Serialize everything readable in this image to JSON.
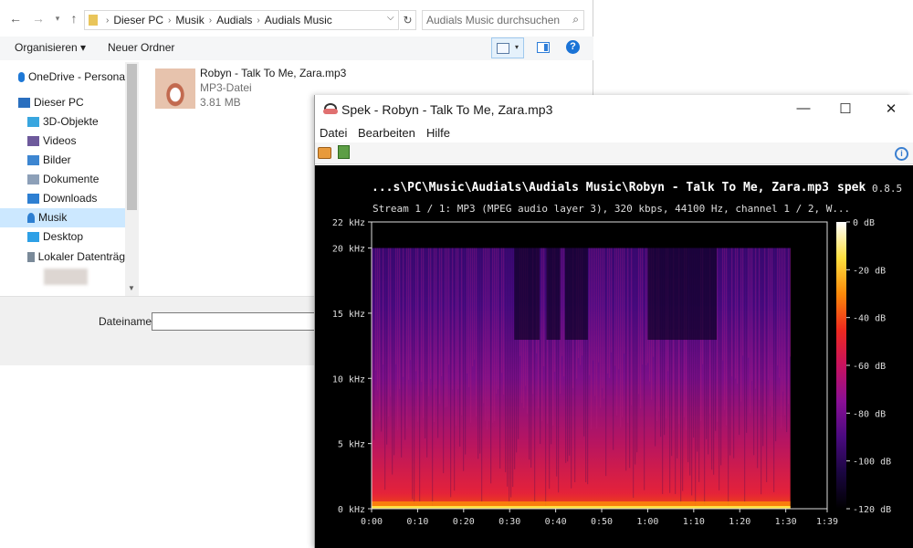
{
  "explorer": {
    "breadcrumb": [
      "Dieser PC",
      "Musik",
      "Audials",
      "Audials Music"
    ],
    "search_placeholder": "Audials Music durchsuchen",
    "toolbar": {
      "organize": "Organisieren ▾",
      "new_folder": "Neuer Ordner",
      "help": "?"
    },
    "nav_items": [
      {
        "label": "OneDrive - Persona",
        "icon": "cloud-icon",
        "color": "#1e78d6"
      },
      {
        "label": "Dieser PC",
        "icon": "computer-icon",
        "color": "#2a6fbf"
      },
      {
        "label": "3D-Objekte",
        "icon": "cube-icon",
        "color": "#39a6df"
      },
      {
        "label": "Videos",
        "icon": "film-icon",
        "color": "#6e5a9c"
      },
      {
        "label": "Bilder",
        "icon": "picture-icon",
        "color": "#3d86d1"
      },
      {
        "label": "Dokumente",
        "icon": "document-icon",
        "color": "#8da0b8"
      },
      {
        "label": "Downloads",
        "icon": "download-arrow-icon",
        "color": "#2d7fd2"
      },
      {
        "label": "Musik",
        "icon": "music-note-icon",
        "color": "#2d7fd2",
        "selected": true
      },
      {
        "label": "Desktop",
        "icon": "desktop-icon",
        "color": "#2ea0e6"
      },
      {
        "label": "Lokaler Datenträg",
        "icon": "drive-icon",
        "color": "#7a8a99"
      }
    ],
    "file": {
      "name": "Robyn - Talk To Me, Zara.mp3",
      "type": "MP3-Datei",
      "size": "3.81 MB"
    },
    "filename_label": "Dateiname:"
  },
  "spek": {
    "title": "Spek - Robyn - Talk To Me, Zara.mp3",
    "menu": [
      "Datei",
      "Bearbeiten",
      "Hilfe"
    ],
    "path": "...s\\PC\\Music\\Audials\\Audials Music\\Robyn - Talk To Me, Zara.mp3",
    "brand": "spek",
    "version": "0.8.5",
    "stream_info": "Stream 1 / 1: MP3 (MPEG audio layer 3), 320 kbps, 44100 Hz, channel 1 / 2, W..."
  },
  "chart_data": {
    "type": "heatmap",
    "title": "",
    "xlabel": "",
    "ylabel": "",
    "x_ticks": [
      "0:00",
      "0:10",
      "0:20",
      "0:30",
      "0:40",
      "0:50",
      "1:00",
      "1:10",
      "1:20",
      "1:30",
      "1:39"
    ],
    "y_ticks": [
      "0 kHz",
      "5 kHz",
      "10 kHz",
      "15 kHz",
      "20 kHz",
      "22 kHz"
    ],
    "y_values_khz": [
      0,
      5,
      10,
      15,
      20,
      22
    ],
    "xlim_seconds": [
      0,
      99
    ],
    "ylim_khz": [
      0,
      22
    ],
    "signal_end_seconds": 91,
    "cutoff_khz": 20,
    "colorbar_ticks": [
      "0 dB",
      "-20 dB",
      "-40 dB",
      "-60 dB",
      "-80 dB",
      "-100 dB",
      "-120 dB"
    ],
    "colorbar_values_db": [
      0,
      -20,
      -40,
      -60,
      -80,
      -100,
      -120
    ],
    "colormap": [
      "#000000",
      "#1a0640",
      "#4a0a80",
      "#8a0f96",
      "#c8125e",
      "#ef2a1e",
      "#fb8a0a",
      "#ffe040",
      "#ffffff"
    ]
  }
}
